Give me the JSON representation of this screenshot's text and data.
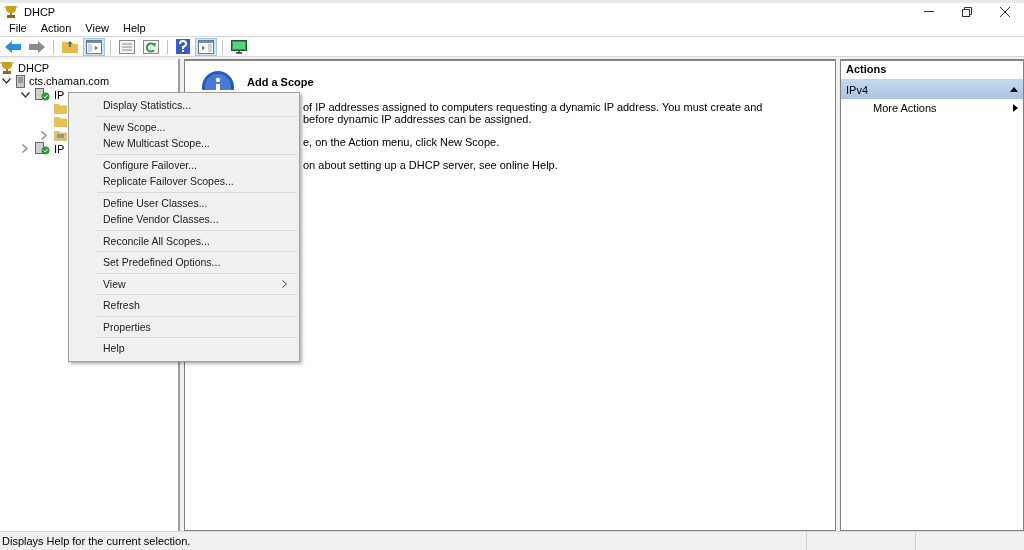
{
  "window": {
    "title": "DHCP"
  },
  "menu_bar": [
    "File",
    "Action",
    "View",
    "Help"
  ],
  "toolbar": [
    {
      "kind": "back",
      "selected": false
    },
    {
      "kind": "forward",
      "selected": false
    },
    {
      "kind": "sep"
    },
    {
      "kind": "folder-up",
      "selected": false
    },
    {
      "kind": "tree",
      "selected": true
    },
    {
      "kind": "sep"
    },
    {
      "kind": "export",
      "selected": false
    },
    {
      "kind": "refresh",
      "selected": false
    },
    {
      "kind": "sep"
    },
    {
      "kind": "help",
      "selected": false
    },
    {
      "kind": "pane",
      "selected": true
    },
    {
      "kind": "sep"
    },
    {
      "kind": "monitor",
      "selected": false
    }
  ],
  "tree": [
    {
      "kind": "root",
      "label": "DHCP",
      "children": [
        {
          "kind": "server",
          "label": "cts.chaman.com",
          "expanded": true,
          "children": [
            {
              "kind": "protocol",
              "label": "IP",
              "expanded": true,
              "children": [
                {
                  "kind": "folder",
                  "expandable": false
                },
                {
                  "kind": "folder",
                  "expandable": false
                },
                {
                  "kind": "folder-list",
                  "expandable": true
                }
              ]
            },
            {
              "kind": "protocol",
              "label": "IP",
              "expanded": false
            }
          ]
        }
      ]
    }
  ],
  "content": {
    "title": "Add a Scope",
    "paragraphs": [
      "of IP addresses assigned to computers requesting a dynamic IP address. You must create and\nbefore dynamic IP addresses can be assigned.",
      "e, on the Action menu, click New Scope.",
      "on about setting up a DHCP server, see online Help."
    ]
  },
  "context_menu": [
    [
      {
        "label": "Display Statistics...",
        "submenu": false
      }
    ],
    [
      {
        "label": "New Scope...",
        "submenu": false
      },
      {
        "label": "New Multicast Scope...",
        "submenu": false
      }
    ],
    [
      {
        "label": "Configure Failover...",
        "submenu": false
      },
      {
        "label": "Replicate Failover Scopes...",
        "submenu": false
      }
    ],
    [
      {
        "label": "Define User Classes...",
        "submenu": false
      },
      {
        "label": "Define Vendor Classes...",
        "submenu": false
      }
    ],
    [
      {
        "label": "Reconcile All Scopes...",
        "submenu": false
      }
    ],
    [
      {
        "label": "Set Predefined Options...",
        "submenu": false
      }
    ],
    [
      {
        "label": "View",
        "submenu": true
      }
    ],
    [
      {
        "label": "Refresh",
        "submenu": false
      }
    ],
    [
      {
        "label": "Properties",
        "submenu": false
      }
    ],
    [
      {
        "label": "Help",
        "submenu": false
      }
    ]
  ],
  "actions": {
    "title": "Actions",
    "sections": [
      {
        "label": "IPv4",
        "expanded": true,
        "items": [
          {
            "label": "More Actions",
            "submenu": true
          }
        ]
      }
    ]
  },
  "status_bar": {
    "text": "Displays Help for the current selection."
  }
}
